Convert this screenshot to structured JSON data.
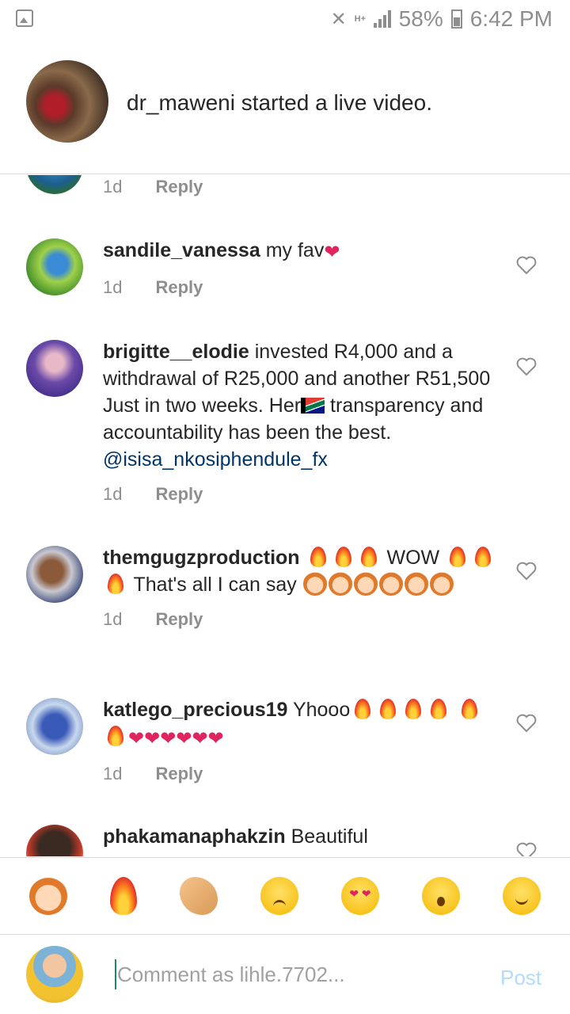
{
  "status_bar": {
    "network": "H+",
    "battery": "58%",
    "time": "6:42 PM"
  },
  "notification": {
    "text": "dr_maweni started a live video."
  },
  "partial_comment": {
    "time": "1d",
    "reply": "Reply"
  },
  "comments": [
    {
      "username": "sandile_vanessa",
      "text": "my fav",
      "time": "1d",
      "reply": "Reply"
    },
    {
      "username": "brigitte__elodie",
      "text": "invested R4,000 and a withdrawal of R25,000 and another R51,500 Just in two weeks. Her",
      "text2": "transparency and accountability has been the best.",
      "mention": "@isisa_nkosiphendule_fx",
      "time": "1d",
      "reply": "Reply"
    },
    {
      "username": "themgugzproduction",
      "text": "WOW",
      "text2": "That's all I can say",
      "time": "1d",
      "reply": "Reply"
    },
    {
      "username": "katlego_precious19",
      "text": "Yhooo",
      "time": "1d",
      "reply": "Reply"
    },
    {
      "username": "phakamanaphakzin",
      "text": "Beautiful"
    }
  ],
  "emoji_bar": [
    "raising-hands",
    "fire",
    "clapping-hands",
    "crying-face",
    "heart-eyes-face",
    "surprised-face",
    "tears-of-joy-face"
  ],
  "composer": {
    "placeholder": "Comment as lihle.7702...",
    "post_label": "Post"
  },
  "colors": {
    "mention": "#003569",
    "post_disabled": "#b3dbff",
    "meta_gray": "#8e8e8e"
  }
}
